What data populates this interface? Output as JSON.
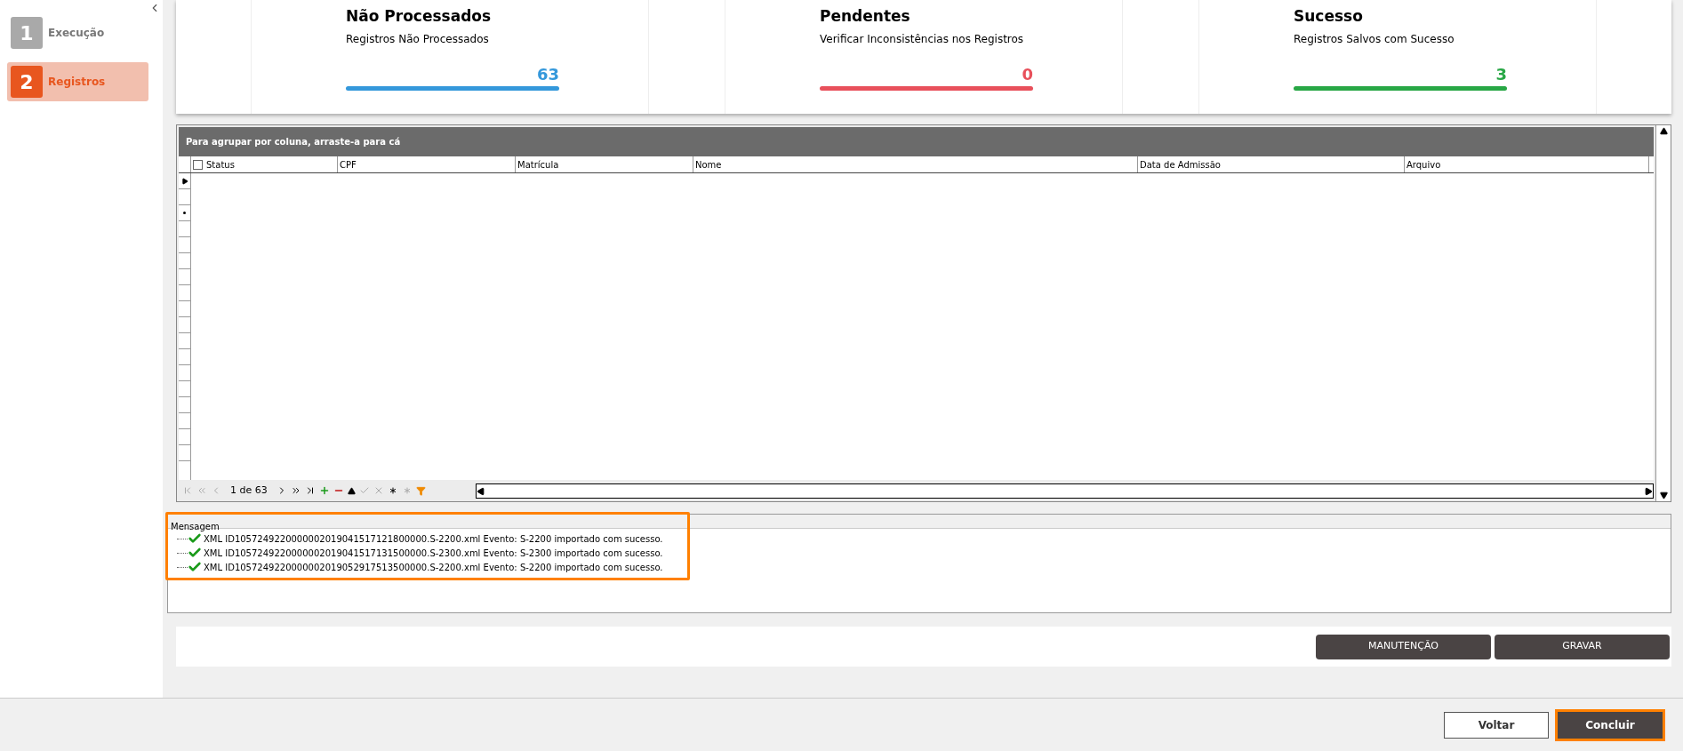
{
  "steps": [
    {
      "number": "1",
      "label": "Execução",
      "selected": false
    },
    {
      "number": "2",
      "label": "Registros",
      "selected": true
    }
  ],
  "cards": [
    {
      "title": "Não Processados",
      "subtitle": "Registros Não Processados",
      "value": "63",
      "color": "#3498db"
    },
    {
      "title": "Pendentes",
      "subtitle": "Verificar Inconsistências nos Registros",
      "value": "0",
      "color": "#e8505b"
    },
    {
      "title": "Sucesso",
      "subtitle": "Registros Salvos com Sucesso",
      "value": "3",
      "color": "#28a745"
    }
  ],
  "grid": {
    "group_hint": "Para agrupar por coluna, arraste-a para cá",
    "columns": [
      "Status",
      "CPF",
      "Matrícula",
      "Nome",
      "Data de Admissão",
      "Arquivo"
    ],
    "pager": "1 de 63",
    "select_all_checked": false
  },
  "messages": {
    "header": "Mensagem",
    "highlighted": true,
    "items": [
      "XML ID1057249220000002019041517121800000.S-2200.xml Evento: S-2200 importado com sucesso.",
      "XML ID1057249220000002019041517131500000.S-2300.xml Evento: S-2300 importado com sucesso.",
      "XML ID1057249220000002019052917513500000.S-2200.xml Evento: S-2200 importado com sucesso."
    ]
  },
  "actions": [
    "MANUTENÇÃO",
    "GRAVAR"
  ],
  "footer_buttons": [
    {
      "label": "Voltar",
      "kind": "secondary",
      "highlighted": false
    },
    {
      "label": "Concluir",
      "kind": "primary",
      "highlighted": true
    }
  ]
}
